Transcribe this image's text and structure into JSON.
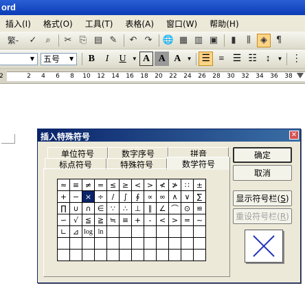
{
  "window": {
    "title": "ord"
  },
  "menu": [
    "插入(I)",
    "格式(O)",
    "工具(T)",
    "表格(A)",
    "窗口(W)",
    "帮助(H)"
  ],
  "toolbar1_icons": [
    "繁-",
    "spell-icon",
    "research-icon",
    "cut-icon",
    "copy-icon",
    "paste-icon",
    "format-painter-icon",
    "undo-icon",
    "redo-icon",
    "hyperlink-icon",
    "tables-icon",
    "insert-table-icon",
    "excel-icon",
    "columns-icon",
    "drawing-icon",
    "docmap-icon",
    "showhide-icon"
  ],
  "format_toolbar": {
    "font_size": "五号",
    "bold": "B",
    "italic": "I",
    "underline": "U",
    "font_color": "A",
    "char_shading": "A",
    "char_scale": "A",
    "align_left_active": true
  },
  "ruler_numbers": [
    "2",
    "2",
    "4",
    "6",
    "8",
    "10",
    "12",
    "14",
    "16",
    "18",
    "20",
    "22",
    "24",
    "26",
    "28",
    "30",
    "32",
    "34",
    "36",
    "38"
  ],
  "dialog": {
    "title": "插入特殊符号",
    "tabs_row1": [
      "单位符号",
      "数字序号",
      "拼音"
    ],
    "tabs_row2": [
      "标点符号",
      "特殊符号",
      "数学符号"
    ],
    "selected_tab": "数学符号",
    "symbols": [
      [
        "≈",
        "≡",
        "≠",
        "=",
        "≤",
        "≥",
        "<",
        ">",
        "≮",
        "≯",
        "∷",
        "±"
      ],
      [
        "+",
        "−",
        "×",
        "÷",
        "/",
        "∫",
        "∮",
        "∝",
        "∞",
        "∧",
        "∨",
        "∑"
      ],
      [
        "∏",
        "∪",
        "∩",
        "∈",
        "∵",
        "∴",
        "⊥",
        "∥",
        "∠",
        "⌒",
        "⊙",
        "≌"
      ],
      [
        "∽",
        "√",
        "≦",
        "≧",
        "≒",
        "≡",
        "+",
        "-",
        "<",
        ">",
        "=",
        "~"
      ],
      [
        "∟",
        "⊿",
        "log",
        "ln",
        "",
        "",
        "",
        "",
        "",
        "",
        "",
        ""
      ],
      [
        "",
        "",
        "",
        "",
        "",
        "",
        "",
        "",
        "",
        "",
        "",
        ""
      ],
      [
        "",
        "",
        "",
        "",
        "",
        "",
        "",
        "",
        "",
        "",
        "",
        ""
      ]
    ],
    "selected_symbol": "×",
    "buttons": {
      "ok": "确定",
      "cancel": "取消",
      "show_bar": "显示符号栏(S)",
      "reset_bar": "重设符号栏(R)"
    },
    "preview_symbol": "×"
  },
  "colors": {
    "titlebar": "#0a3cb4",
    "dialog_title": "#0a246a",
    "chrome": "#ece9d8",
    "selection": "#0a246a"
  }
}
